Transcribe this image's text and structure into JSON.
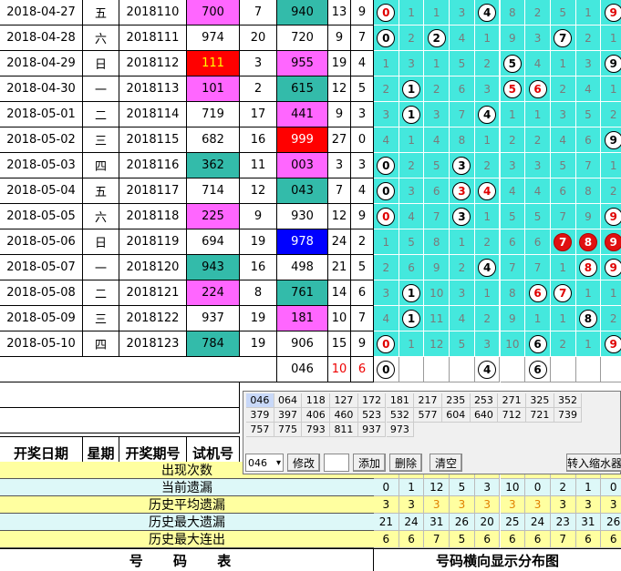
{
  "columns": {
    "date": "开奖日期",
    "weekday": "星期",
    "issue": "开奖期号",
    "test": "试机号"
  },
  "rows": [
    {
      "date": "2018-04-27",
      "wd": "五",
      "issue": "2018110",
      "test": "700",
      "tc": "#ff66ff",
      "n2": "7",
      "draw": "940",
      "dc": "#33bbaa",
      "s": "13",
      "k": "9",
      "g": [
        "0",
        "1",
        "1",
        "3",
        "4",
        "8",
        "2",
        "5",
        "1",
        "9"
      ],
      "b": [
        [
          0,
          "r"
        ],
        [
          4,
          ""
        ],
        [
          9,
          "r"
        ]
      ]
    },
    {
      "date": "2018-04-28",
      "wd": "六",
      "issue": "2018111",
      "test": "974",
      "tc": "#ffffff",
      "n2": "20",
      "draw": "720",
      "dc": "#ffffff",
      "s": "9",
      "k": "7",
      "g": [
        "0",
        "2",
        "2",
        "4",
        "1",
        "9",
        "3",
        "7",
        "2",
        "1"
      ],
      "b": [
        [
          0,
          ""
        ],
        [
          2,
          ""
        ],
        [
          7,
          ""
        ]
      ]
    },
    {
      "date": "2018-04-29",
      "wd": "日",
      "issue": "2018112",
      "test": "111",
      "tc": "#ff0000",
      "n2": "3",
      "draw": "955",
      "dc": "#ff66ff",
      "s": "19",
      "k": "4",
      "g": [
        "1",
        "3",
        "1",
        "5",
        "2",
        "5",
        "4",
        "1",
        "3",
        "9"
      ],
      "b": [
        [
          5,
          ""
        ],
        [
          9,
          ""
        ]
      ]
    },
    {
      "date": "2018-04-30",
      "wd": "一",
      "issue": "2018113",
      "test": "101",
      "tc": "#ff66ff",
      "n2": "2",
      "draw": "615",
      "dc": "#33bbaa",
      "s": "12",
      "k": "5",
      "g": [
        "2",
        "1",
        "2",
        "6",
        "3",
        "5",
        "6",
        "2",
        "4",
        "1"
      ],
      "b": [
        [
          1,
          ""
        ],
        [
          5,
          "r"
        ],
        [
          6,
          "r"
        ]
      ]
    },
    {
      "date": "2018-05-01",
      "wd": "二",
      "issue": "2018114",
      "test": "719",
      "tc": "#ffffff",
      "n2": "17",
      "draw": "441",
      "dc": "#ff66ff",
      "s": "9",
      "k": "3",
      "g": [
        "3",
        "1",
        "3",
        "7",
        "4",
        "1",
        "1",
        "3",
        "5",
        "2"
      ],
      "b": [
        [
          1,
          ""
        ],
        [
          4,
          ""
        ]
      ]
    },
    {
      "date": "2018-05-02",
      "wd": "三",
      "issue": "2018115",
      "test": "682",
      "tc": "#ffffff",
      "n2": "16",
      "draw": "999",
      "dc": "#ff0000",
      "s": "27",
      "k": "0",
      "g": [
        "4",
        "1",
        "4",
        "8",
        "1",
        "2",
        "2",
        "4",
        "6",
        "9"
      ],
      "b": [
        [
          9,
          ""
        ]
      ]
    },
    {
      "date": "2018-05-03",
      "wd": "四",
      "issue": "2018116",
      "test": "362",
      "tc": "#33bbaa",
      "n2": "11",
      "draw": "003",
      "dc": "#ff66ff",
      "s": "3",
      "k": "3",
      "g": [
        "0",
        "2",
        "5",
        "3",
        "2",
        "3",
        "3",
        "5",
        "7",
        "1"
      ],
      "b": [
        [
          0,
          ""
        ],
        [
          3,
          ""
        ]
      ]
    },
    {
      "date": "2018-05-04",
      "wd": "五",
      "issue": "2018117",
      "test": "714",
      "tc": "#ffffff",
      "n2": "12",
      "draw": "043",
      "dc": "#33bbaa",
      "s": "7",
      "k": "4",
      "g": [
        "0",
        "3",
        "6",
        "3",
        "4",
        "4",
        "4",
        "6",
        "8",
        "2"
      ],
      "b": [
        [
          0,
          ""
        ],
        [
          3,
          "r"
        ],
        [
          4,
          "r"
        ]
      ]
    },
    {
      "date": "2018-05-05",
      "wd": "六",
      "issue": "2018118",
      "test": "225",
      "tc": "#ff66ff",
      "n2": "9",
      "draw": "930",
      "dc": "#ffffff",
      "s": "12",
      "k": "9",
      "g": [
        "0",
        "4",
        "7",
        "3",
        "1",
        "5",
        "5",
        "7",
        "9",
        "9"
      ],
      "b": [
        [
          0,
          "r"
        ],
        [
          3,
          ""
        ],
        [
          9,
          "r"
        ]
      ]
    },
    {
      "date": "2018-05-06",
      "wd": "日",
      "issue": "2018119",
      "test": "694",
      "tc": "#ffffff",
      "n2": "19",
      "draw": "978",
      "dc": "#0000ff",
      "s": "24",
      "k": "2",
      "g": [
        "1",
        "5",
        "8",
        "1",
        "2",
        "6",
        "6",
        "7",
        "8",
        "9"
      ],
      "b": [
        [
          7,
          "f"
        ],
        [
          8,
          "f"
        ],
        [
          9,
          "f"
        ]
      ]
    },
    {
      "date": "2018-05-07",
      "wd": "一",
      "issue": "2018120",
      "test": "943",
      "tc": "#33bbaa",
      "n2": "16",
      "draw": "498",
      "dc": "#ffffff",
      "s": "21",
      "k": "5",
      "g": [
        "2",
        "6",
        "9",
        "2",
        "4",
        "7",
        "7",
        "1",
        "8",
        "9"
      ],
      "b": [
        [
          4,
          ""
        ],
        [
          8,
          "r"
        ],
        [
          9,
          "r"
        ]
      ]
    },
    {
      "date": "2018-05-08",
      "wd": "二",
      "issue": "2018121",
      "test": "224",
      "tc": "#ff66ff",
      "n2": "8",
      "draw": "761",
      "dc": "#33bbaa",
      "s": "14",
      "k": "6",
      "g": [
        "3",
        "1",
        "10",
        "3",
        "1",
        "8",
        "6",
        "7",
        "1",
        "1"
      ],
      "b": [
        [
          1,
          ""
        ],
        [
          6,
          "r"
        ],
        [
          7,
          "r"
        ]
      ]
    },
    {
      "date": "2018-05-09",
      "wd": "三",
      "issue": "2018122",
      "test": "937",
      "tc": "#ffffff",
      "n2": "19",
      "draw": "181",
      "dc": "#ff66ff",
      "s": "10",
      "k": "7",
      "g": [
        "4",
        "1",
        "11",
        "4",
        "2",
        "9",
        "1",
        "1",
        "8",
        "2"
      ],
      "b": [
        [
          1,
          ""
        ],
        [
          8,
          ""
        ]
      ]
    },
    {
      "date": "2018-05-10",
      "wd": "四",
      "issue": "2018123",
      "test": "784",
      "tc": "#33bbaa",
      "n2": "19",
      "draw": "906",
      "dc": "#ffffff",
      "s": "15",
      "k": "9",
      "g": [
        "0",
        "1",
        "12",
        "5",
        "3",
        "10",
        "6",
        "2",
        "1",
        "9"
      ],
      "b": [
        [
          0,
          "r"
        ],
        [
          6,
          ""
        ],
        [
          9,
          "r"
        ]
      ]
    }
  ],
  "pending": {
    "draw": "046",
    "s": "10",
    "k": "6",
    "balls": [
      [
        0,
        "0"
      ],
      [
        4,
        "4"
      ],
      [
        6,
        "6"
      ]
    ]
  },
  "popup": {
    "rows": [
      [
        "046",
        "064",
        "118",
        "127",
        "172",
        "181",
        "217",
        "235",
        "253",
        "271",
        "325",
        "352"
      ],
      [
        "379",
        "397",
        "406",
        "460",
        "523",
        "532",
        "577",
        "604",
        "640",
        "712",
        "721",
        "739"
      ],
      [
        "757",
        "775",
        "793",
        "811",
        "937",
        "973"
      ]
    ],
    "select_value": "046",
    "btn_modify": "修改",
    "btn_add": "添加",
    "btn_delete": "删除",
    "btn_clear": "清空",
    "btn_transfer": "转入缩水器"
  },
  "stats": {
    "labels": [
      "出现次数",
      "当前遗漏",
      "历史平均遗漏",
      "历史最大遗漏",
      "历史最大连出"
    ],
    "values": [
      [
        "",
        "",
        "",
        "",
        "",
        "",
        "",
        "",
        "",
        ""
      ],
      [
        "0",
        "1",
        "12",
        "5",
        "3",
        "10",
        "0",
        "2",
        "1",
        "0"
      ],
      [
        "3",
        "3",
        "3",
        "3",
        "3",
        "3",
        "3",
        "3",
        "3",
        "3"
      ],
      [
        "21",
        "24",
        "31",
        "26",
        "20",
        "25",
        "24",
        "23",
        "31",
        "26"
      ],
      [
        "6",
        "6",
        "7",
        "5",
        "6",
        "6",
        "6",
        "7",
        "6",
        "6"
      ]
    ],
    "colors": [
      "#ffffa0",
      "#ddf8f8",
      "#ffffa0",
      "#ddf8f8",
      "#ffffa0"
    ]
  },
  "footer": {
    "left": "号 码 表",
    "right": "号码横向显示分布图"
  }
}
